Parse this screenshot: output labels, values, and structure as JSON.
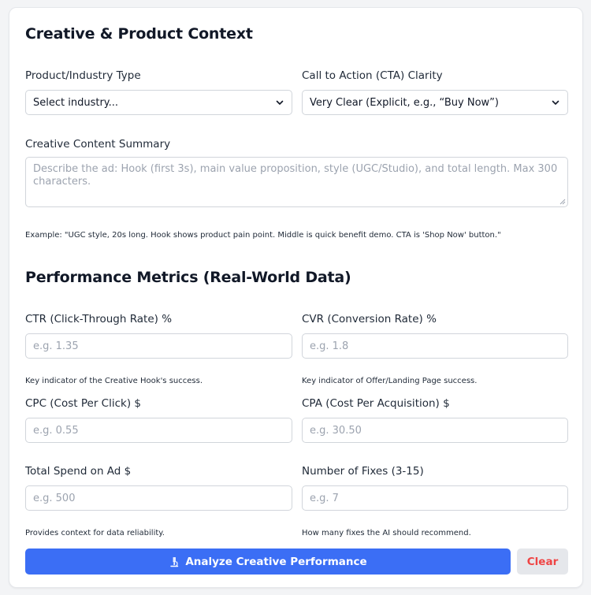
{
  "creative_section": {
    "title": "Creative & Product Context",
    "industry": {
      "label": "Product/Industry Type",
      "value": "Select industry..."
    },
    "cta": {
      "label": "Call to Action (CTA) Clarity",
      "value": "Very Clear (Explicit, e.g., “Buy Now”)"
    },
    "summary": {
      "label": "Creative Content Summary",
      "placeholder": "Describe the ad: Hook (first 3s), main value proposition, style (UGC/Studio), and total length. Max 300 characters.",
      "example": "Example: \"UGC style, 20s long. Hook shows product pain point. Middle is quick benefit demo. CTA is 'Shop Now' button.\""
    }
  },
  "metrics_section": {
    "title": "Performance Metrics (Real-World Data)",
    "ctr": {
      "label": "CTR (Click-Through Rate) %",
      "placeholder": "e.g. 1.35",
      "hint": "Key indicator of the Creative Hook's success."
    },
    "cvr": {
      "label": "CVR (Conversion Rate) %",
      "placeholder": "e.g. 1.8",
      "hint": "Key indicator of Offer/Landing Page success."
    },
    "cpc": {
      "label": "CPC (Cost Per Click) $",
      "placeholder": "e.g. 0.55"
    },
    "cpa": {
      "label": "CPA (Cost Per Acquisition) $",
      "placeholder": "e.g. 30.50"
    },
    "spend": {
      "label": "Total Spend on Ad $",
      "placeholder": "e.g. 500",
      "hint": "Provides context for data reliability."
    },
    "fixes": {
      "label": "Number of Fixes (3-15)",
      "placeholder": "e.g. 7",
      "hint": "How many fixes the AI should recommend."
    }
  },
  "actions": {
    "analyze_label": "Analyze Creative Performance",
    "analyze_icon": "microscope-icon",
    "clear_label": "Clear"
  },
  "colors": {
    "primary": "#3b6ef5",
    "danger": "#ef4444",
    "border": "#d1d5db",
    "placeholder": "#9ca3af"
  }
}
